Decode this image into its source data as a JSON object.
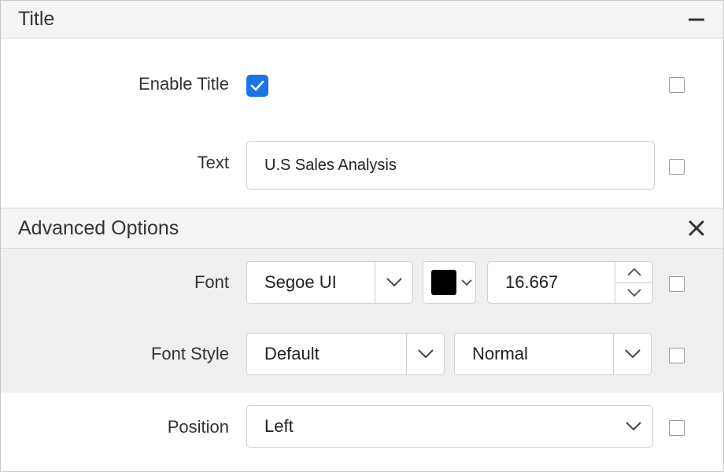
{
  "title_section": {
    "header": "Title",
    "collapse_icon": "minus-icon",
    "enable_title": {
      "label": "Enable Title",
      "checked": true
    },
    "text": {
      "label": "Text",
      "value": "U.S Sales Analysis"
    }
  },
  "advanced_section": {
    "header": "Advanced Options",
    "close_icon": "close-icon",
    "font": {
      "label": "Font",
      "family": "Segoe UI",
      "color": "#000000",
      "size": "16.667"
    },
    "font_style": {
      "label": "Font Style",
      "style": "Default",
      "weight": "Normal"
    },
    "position": {
      "label": "Position",
      "value": "Left"
    }
  },
  "colors": {
    "accent": "#1a73e8",
    "header_bg": "#f4f4f4",
    "band_bg": "#efefef"
  }
}
